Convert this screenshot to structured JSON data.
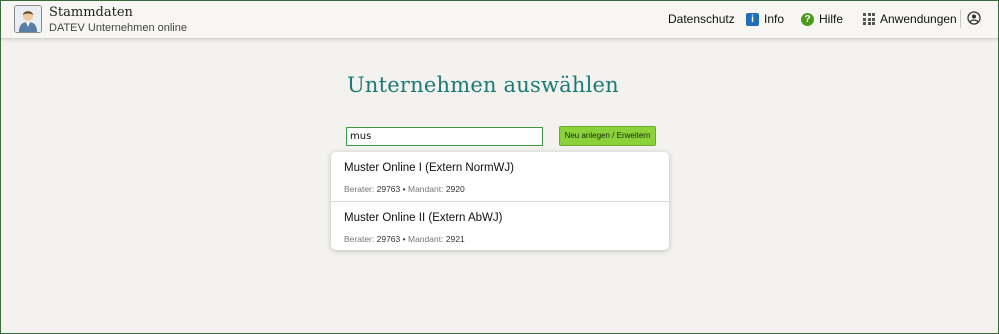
{
  "header": {
    "title": "Stammdaten",
    "subtitle": "DATEV Unternehmen online",
    "nav": {
      "datenschutz": "Datenschutz",
      "info": "Info",
      "hilfe": "Hilfe",
      "anwendungen": "Anwendungen"
    },
    "icons": [
      "user-avatar-icon",
      "info-icon",
      "help-icon",
      "apps-grid-icon",
      "user-account-icon"
    ]
  },
  "main": {
    "title": "Unternehmen auswählen",
    "search": {
      "value": "mus",
      "placeholder": ""
    },
    "new_button_label": "Neu anlegen / Erweitern"
  },
  "results": [
    {
      "name": "Muster Online I (Extern NormWJ)",
      "berater_label": "Berater:",
      "berater": "29763",
      "sep": "•",
      "mandant_label": "Mandant:",
      "mandant": "2920"
    },
    {
      "name": "Muster Online II (Extern AbWJ)",
      "berater_label": "Berater:",
      "berater": "29763",
      "sep": "•",
      "mandant_label": "Mandant:",
      "mandant": "2921"
    }
  ],
  "colors": {
    "title_teal": "#1b7a76",
    "button_green": "#8ad13a",
    "input_border": "#3c9a3c",
    "info_blue": "#1c6fb8",
    "help_green": "#4c9a1e"
  }
}
